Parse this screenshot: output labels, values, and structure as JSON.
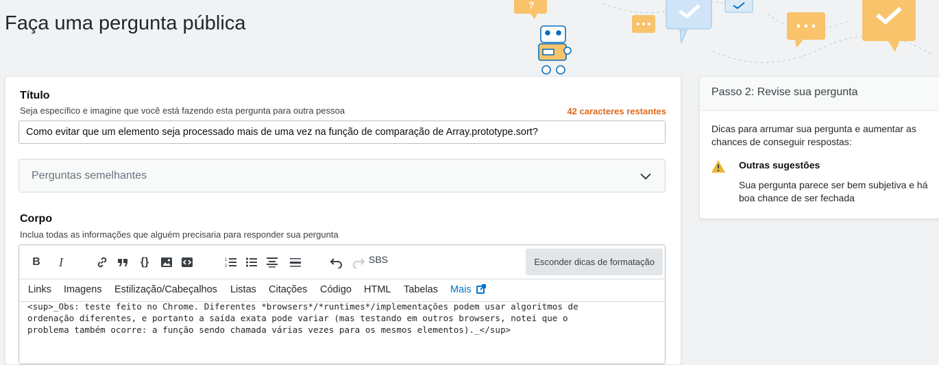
{
  "page": {
    "title": "Faça uma pergunta pública"
  },
  "form": {
    "title_label": "Título",
    "title_desc": "Seja específico e imagine que você está fazendo esta pergunta para outra pessoa",
    "title_remaining": "42 caracteres restantes",
    "title_value": "Como evitar que um elemento seja processado mais de uma vez na função de comparação de Array.prototype.sort?",
    "similar_label": "Perguntas semelhantes",
    "body_label": "Corpo",
    "body_desc": "Inclua todas as informações que alguém precisaria para responder sua pergunta",
    "body_value": "<sup>_Obs: teste feito no Chrome. Diferentes *browsers*/*runtimes*/implementações podem usar algoritmos de\nordenação diferentes, e portanto a saída exata pode variar (mas testando em outros browsers, notei que o\nproblema também ocorre: a função sendo chamada várias vezes para os mesmos elementos)._</sup>"
  },
  "toolbar": {
    "bold": "B",
    "italic": "I",
    "code_block": "{}",
    "sbs": "SBS",
    "hide_tips": "Esconder dicas de formatação",
    "icons": [
      "bold-icon",
      "italic-icon",
      "link-icon",
      "quote-icon",
      "code-icon",
      "image-icon",
      "snippet-icon",
      "ordered-list-icon",
      "unordered-list-icon",
      "heading-icon",
      "horizontal-rule-icon",
      "undo-icon",
      "redo-icon"
    ]
  },
  "tips_tabs": [
    "Links",
    "Imagens",
    "Estilização/Cabeçalhos",
    "Listas",
    "Citações",
    "Código",
    "HTML",
    "Tabelas"
  ],
  "tips_more": "Mais",
  "sidebar": {
    "title": "Passo 2: Revise sua pergunta",
    "intro": "Dicas para arrumar sua pergunta e aumentar as chances de conseguir respostas:",
    "suggestion_title": "Outras sugestões",
    "suggestion_text": "Sua pergunta parece ser bem subjetiva e há boa chance de ser fechada"
  },
  "colors": {
    "accent_orange": "#e0681b",
    "link_blue": "#0074cc",
    "warning_yellow": "#e8b630",
    "illus_orange": "#f8c36a",
    "illus_blue": "#cfe4f7"
  }
}
